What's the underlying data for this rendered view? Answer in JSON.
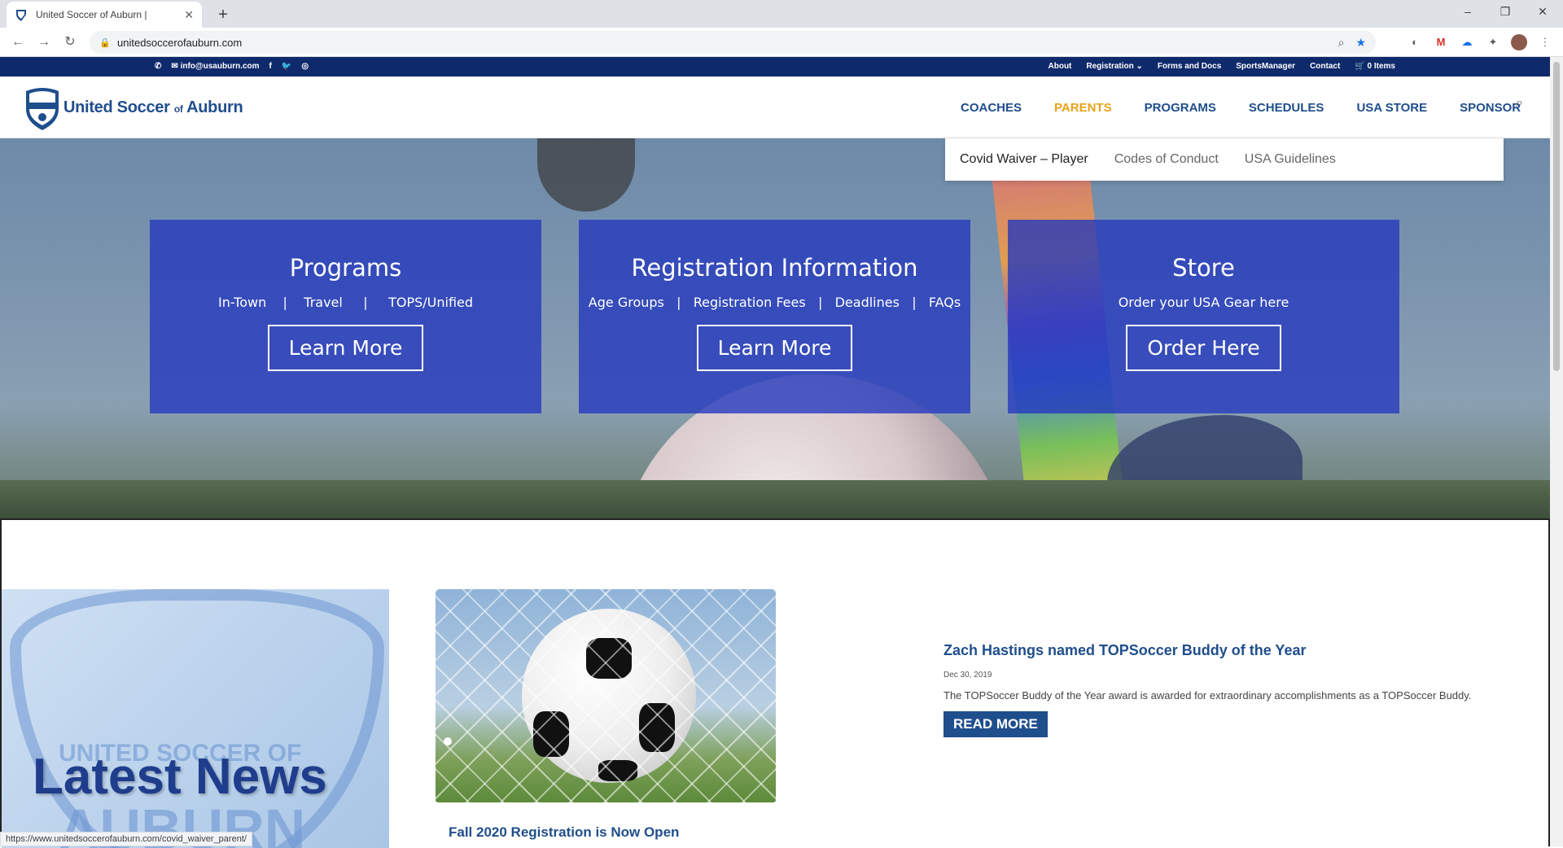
{
  "browser": {
    "tab_title": "United Soccer of Auburn |",
    "url": "unitedsoccerofauburn.com",
    "status_url": "https://www.unitedsoccerofauburn.com/covid_waiver_parent/"
  },
  "topbar": {
    "email": "info@usauburn.com",
    "links": [
      "About",
      "Registration",
      "Forms and Docs",
      "SportsManager",
      "Contact"
    ],
    "cart": "0 Items"
  },
  "header": {
    "logo_text_1": "United Soccer",
    "logo_text_of": "of",
    "logo_text_2": "Auburn",
    "nav": [
      "COACHES",
      "PARENTS",
      "PROGRAMS",
      "SCHEDULES",
      "USA STORE",
      "SPONSOR"
    ]
  },
  "dropdown": {
    "items": [
      "Covid Waiver – Player",
      "Codes of Conduct",
      "USA Guidelines"
    ]
  },
  "hero": {
    "cards": [
      {
        "title": "Programs",
        "links": [
          "In-Town",
          "Travel",
          "TOPS/Unified"
        ],
        "button": "Learn More"
      },
      {
        "title": "Registration Information",
        "links": [
          "Age Groups",
          "Registration Fees",
          "Deadlines",
          "FAQs"
        ],
        "button": "Learn More"
      },
      {
        "title": "Store",
        "subtitle": "Order your USA Gear here",
        "button": "Order Here"
      }
    ]
  },
  "news": {
    "heading": "Latest News",
    "crest_text_1": "UNITED SOCCER OF",
    "crest_text_2": "AUBURN",
    "second_post_title": "Fall 2020 Registration is Now Open",
    "article": {
      "title": "Zach Hastings named TOPSoccer Buddy of the Year",
      "date": "Dec 30, 2019",
      "excerpt": "The TOPSoccer Buddy of the Year award is awarded for extraordinary accomplishments as a TOPSoccer Buddy.",
      "read_more": "READ MORE"
    }
  },
  "colors": {
    "brand_navy": "#0f2a6b",
    "brand_blue": "#1f4e8c",
    "active_nav": "#e8a317",
    "card_blue": "#2337be"
  }
}
